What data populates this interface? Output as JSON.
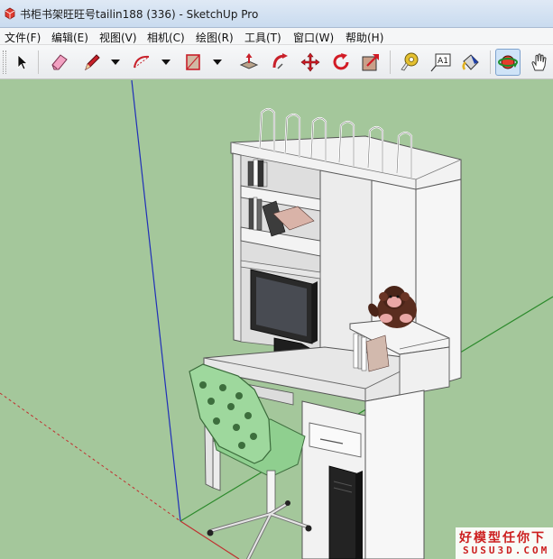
{
  "window": {
    "title": "书柜书架旺旺号tailin188 (336) - SketchUp Pro"
  },
  "menubar": {
    "items": [
      {
        "label": "文件(F)"
      },
      {
        "label": "编辑(E)"
      },
      {
        "label": "视图(V)"
      },
      {
        "label": "相机(C)"
      },
      {
        "label": "绘图(R)"
      },
      {
        "label": "工具(T)"
      },
      {
        "label": "窗口(W)"
      },
      {
        "label": "帮助(H)"
      }
    ]
  },
  "toolbar": {
    "tools": [
      {
        "icon": "select-arrow-icon"
      },
      {
        "icon": "eraser-icon"
      },
      {
        "icon": "pencil-line-icon",
        "dropdown": true
      },
      {
        "icon": "arc-icon",
        "dropdown": true
      },
      {
        "icon": "rectangle-icon",
        "dropdown": true
      },
      {
        "icon": "push-pull-icon"
      },
      {
        "icon": "follow-me-icon"
      },
      {
        "icon": "move-icon"
      },
      {
        "icon": "rotate-icon"
      },
      {
        "icon": "scale-icon"
      },
      {
        "icon": "tape-measure-icon"
      },
      {
        "icon": "text-label-icon",
        "text": "A1"
      },
      {
        "icon": "paint-bucket-icon"
      },
      {
        "icon": "orbit-icon",
        "active": true
      },
      {
        "icon": "pan-hand-icon"
      }
    ]
  },
  "viewport": {
    "background": "#a4c79b",
    "axis_colors": {
      "blue": "#1f2fb8",
      "red": "#c03030",
      "green": "#2c8a2c"
    },
    "model": "bookshelf desk with monitor, chair, shelves and plush monkey"
  },
  "watermark": {
    "line1": "好模型任你下",
    "line2": "SUSU3D.COM"
  },
  "colors": {
    "furniture_white": "#eeeeee",
    "chair_green": "#8fcf8f",
    "monitor_dark": "#2a2a2a",
    "watermark_red": "#cc1f1f"
  }
}
